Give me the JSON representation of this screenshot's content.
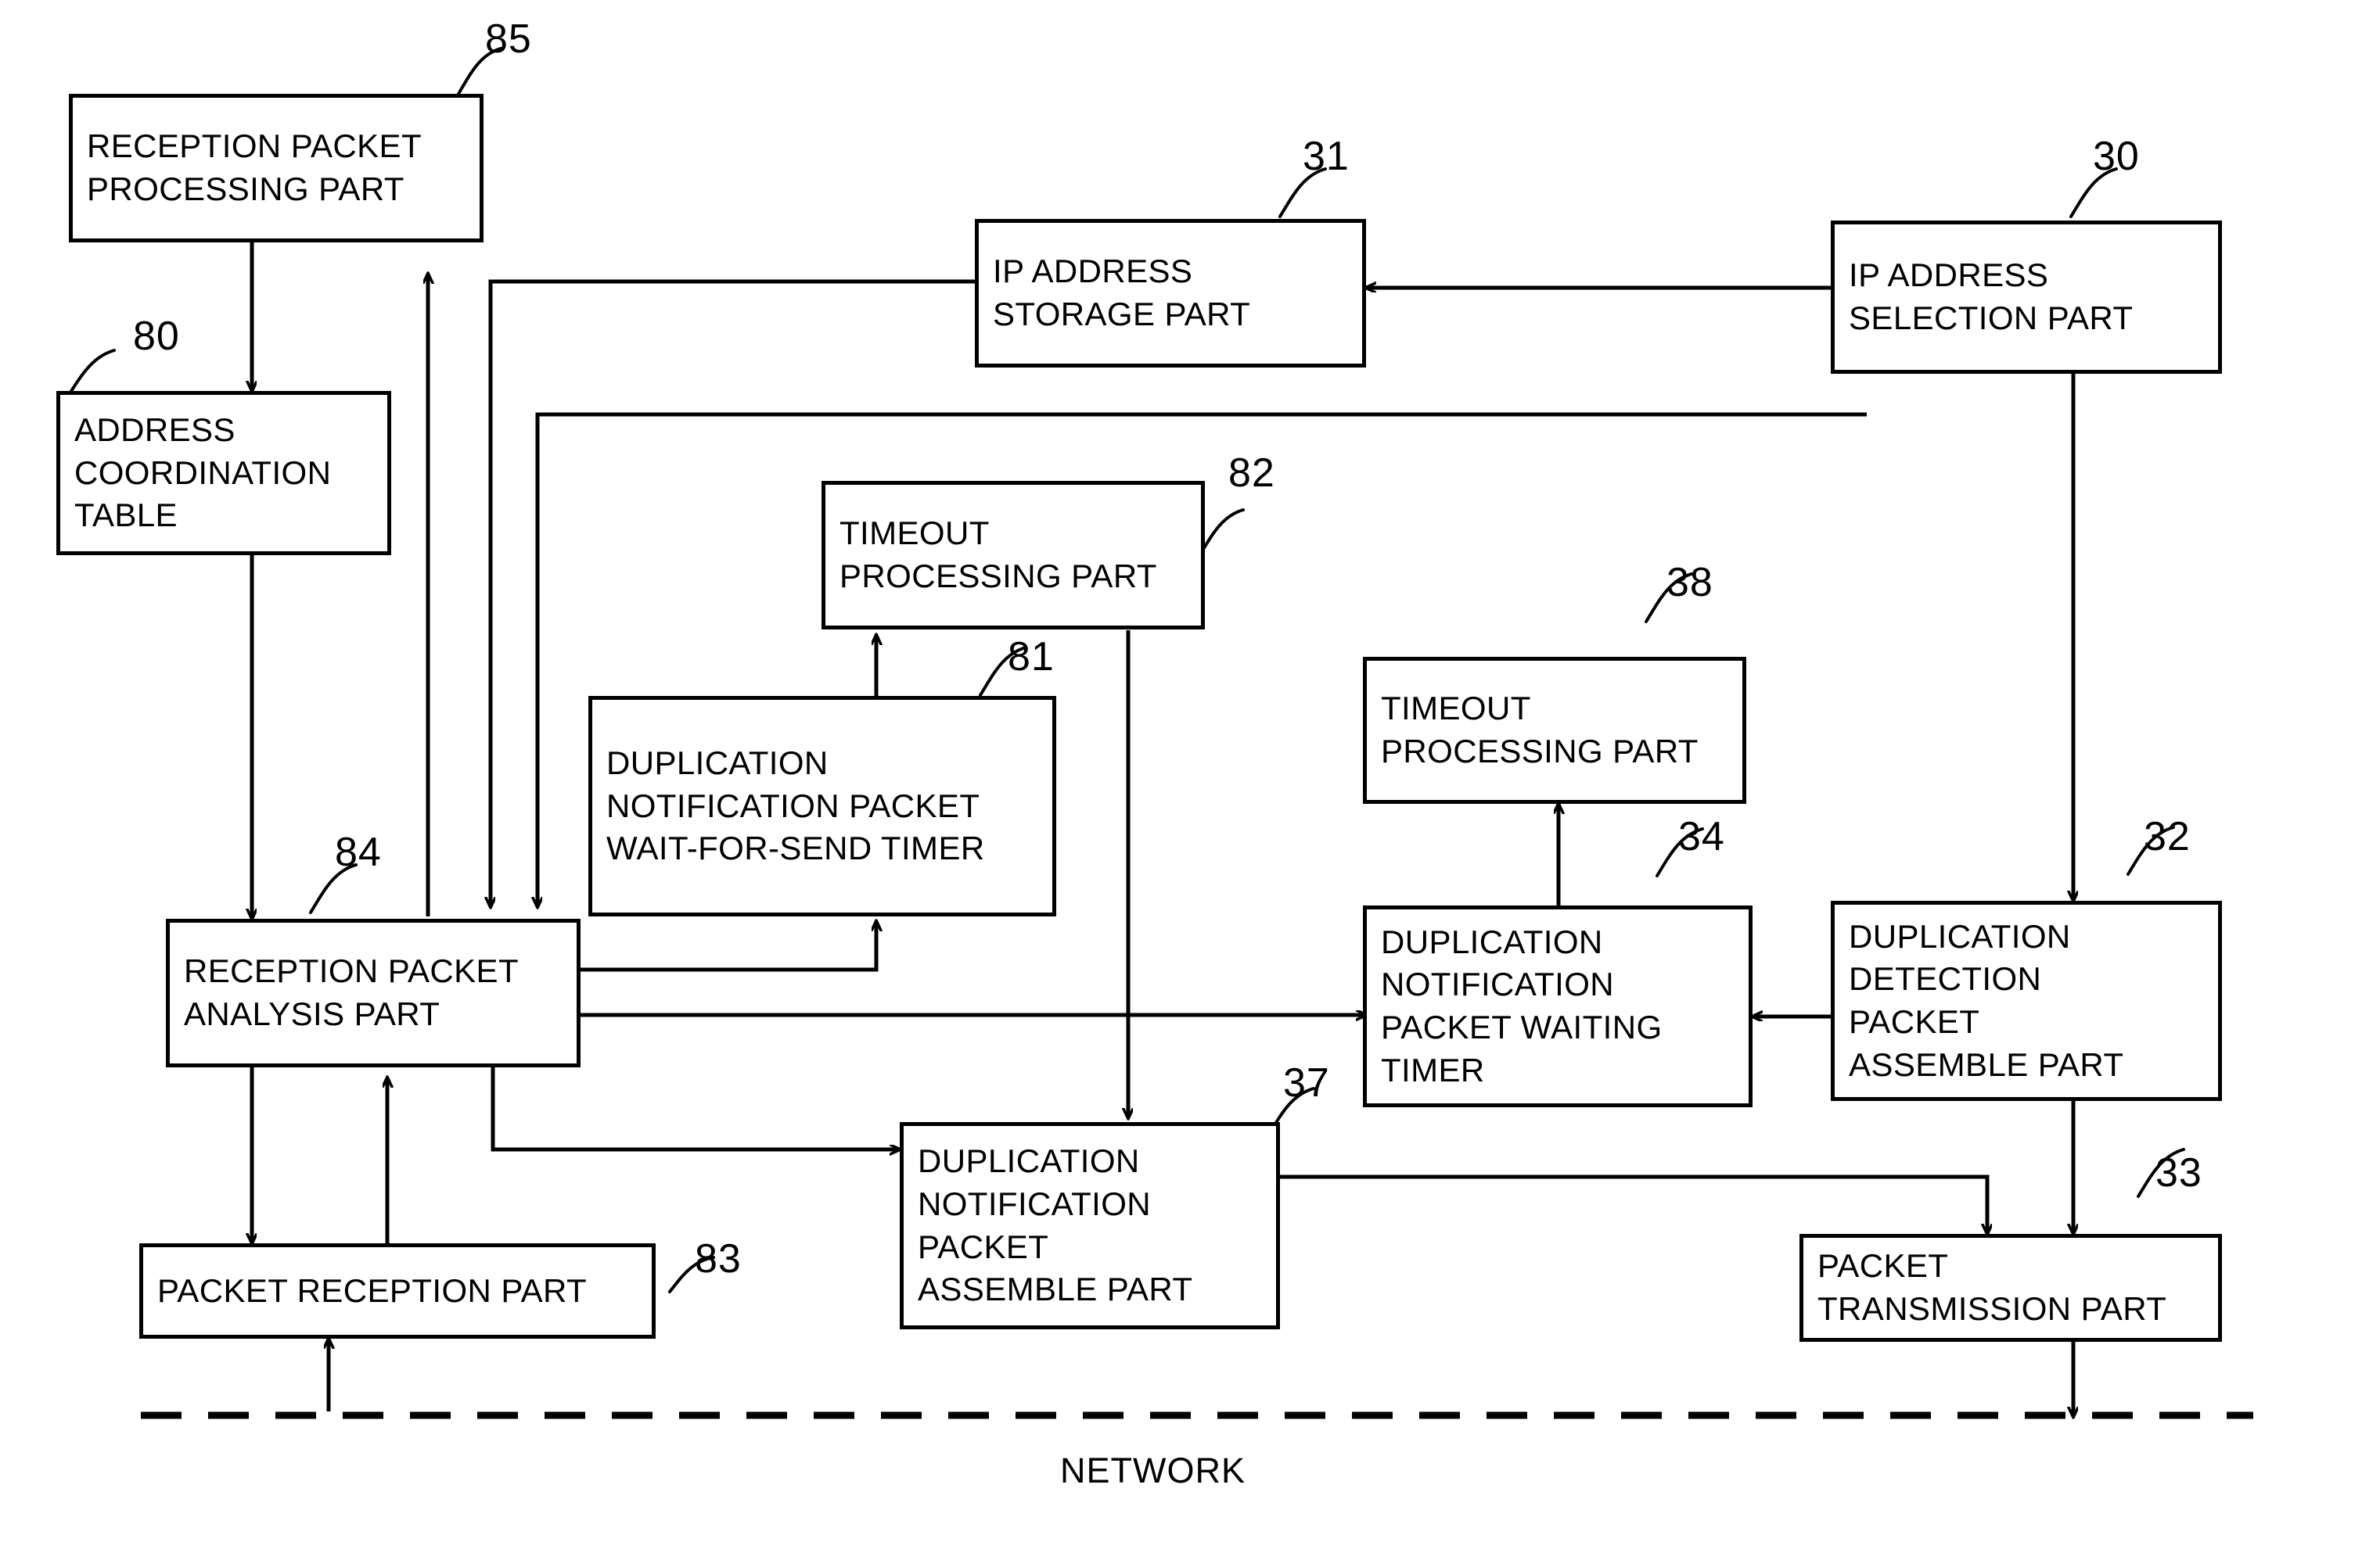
{
  "diagram": {
    "network_label": "NETWORK",
    "boxes": [
      {
        "id": "reception-packet-processing-part",
        "ref": "85",
        "lines": [
          "RECEPTION PACKET",
          "PROCESSING PART"
        ]
      },
      {
        "id": "address-coordination-table",
        "ref": "80",
        "lines": [
          "ADDRESS",
          "COORDINATION",
          "TABLE"
        ]
      },
      {
        "id": "reception-packet-analysis-part",
        "ref": "84",
        "lines": [
          "RECEPTION PACKET",
          "ANALYSIS PART"
        ]
      },
      {
        "id": "packet-reception-part",
        "ref": "83",
        "lines": [
          "PACKET RECEPTION PART"
        ]
      },
      {
        "id": "timeout-processing-part-82",
        "ref": "82",
        "lines": [
          "TIMEOUT",
          "PROCESSING PART"
        ]
      },
      {
        "id": "duplication-notification-packet-wait-for-send-timer",
        "ref": "81",
        "lines": [
          "DUPLICATION",
          "NOTIFICATION PACKET",
          "WAIT-FOR-SEND TIMER"
        ]
      },
      {
        "id": "duplication-notification-packet-assemble-part",
        "ref": "37",
        "lines": [
          "DUPLICATION",
          "NOTIFICATION",
          "PACKET",
          "ASSEMBLE PART"
        ]
      },
      {
        "id": "timeout-processing-part-38",
        "ref": "38",
        "lines": [
          "TIMEOUT",
          "PROCESSING PART"
        ]
      },
      {
        "id": "duplication-notification-packet-waiting-timer",
        "ref": "34",
        "lines": [
          "DUPLICATION",
          "NOTIFICATION",
          "PACKET WAITING",
          "TIMER"
        ]
      },
      {
        "id": "ip-address-storage-part",
        "ref": "31",
        "lines": [
          "IP ADDRESS",
          "STORAGE PART"
        ]
      },
      {
        "id": "ip-address-selection-part",
        "ref": "30",
        "lines": [
          "IP ADDRESS",
          "SELECTION PART"
        ]
      },
      {
        "id": "duplication-detection-packet-assemble-part",
        "ref": "32",
        "lines": [
          "DUPLICATION",
          "DETECTION",
          "PACKET",
          "ASSEMBLE PART"
        ]
      },
      {
        "id": "packet-transmission-part",
        "ref": "33",
        "lines": [
          "PACKET",
          "TRANSMISSION PART"
        ]
      }
    ]
  }
}
